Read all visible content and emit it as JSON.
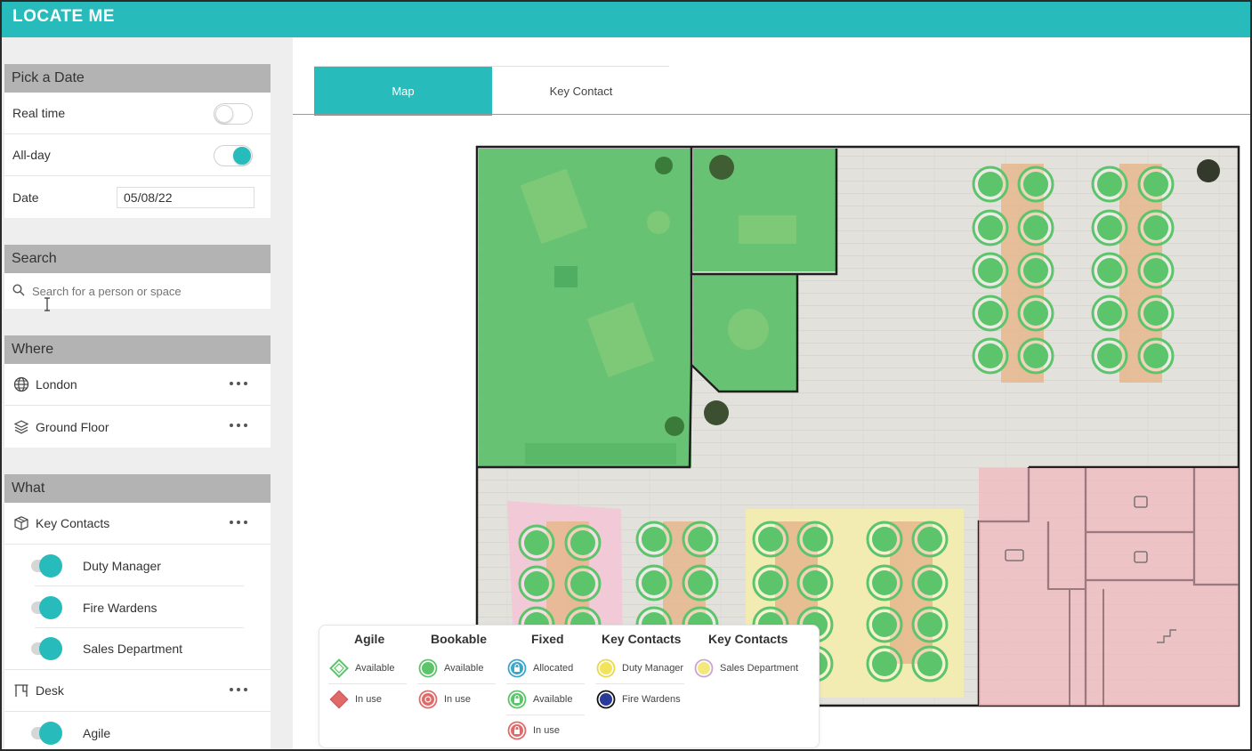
{
  "app": {
    "title": "LOCATE ME"
  },
  "sidebar": {
    "pick_date": {
      "header": "Pick a Date",
      "real_time": {
        "label": "Real time",
        "on": false
      },
      "all_day": {
        "label": "All-day",
        "on": true
      },
      "date": {
        "label": "Date",
        "value": "05/08/22"
      }
    },
    "search": {
      "header": "Search",
      "placeholder": "Search for a person or space"
    },
    "where": {
      "header": "Where",
      "items": [
        {
          "label": "London",
          "icon": "globe-icon"
        },
        {
          "label": "Ground Floor",
          "icon": "layers-icon"
        }
      ]
    },
    "what": {
      "header": "What",
      "key_contacts": {
        "label": "Key Contacts",
        "icon": "box-icon",
        "items": [
          "Duty Manager",
          "Fire Wardens",
          "Sales Department"
        ]
      },
      "desk": {
        "label": "Desk",
        "icon": "desk-icon",
        "items": [
          "Agile"
        ]
      }
    }
  },
  "tabs": [
    {
      "label": "Map",
      "active": true
    },
    {
      "label": "Key Contact",
      "active": false
    }
  ],
  "legend": {
    "columns": [
      {
        "title": "Agile",
        "items": [
          "Available",
          "In use"
        ]
      },
      {
        "title": "Bookable",
        "items": [
          "Available",
          "In use"
        ]
      },
      {
        "title": "Fixed",
        "items": [
          "Allocated",
          "Available",
          "In use"
        ]
      },
      {
        "title": "Key Contacts",
        "items": [
          "Duty Manager",
          "Fire Wardens"
        ]
      },
      {
        "title": "Key Contacts",
        "items": [
          "Sales Department"
        ]
      }
    ]
  },
  "colors": {
    "accent": "#27bcbb",
    "available_green": "#5cc46a",
    "in_use_red": "#e06a6a",
    "allocated_blue": "#3ba7c9",
    "duty_manager_yellow": "#f2e45a",
    "fire_wardens_navy": "#2a3a9a",
    "sales_yellow": "#f4e87c",
    "sales_zone": "#f2ebb2",
    "pink_zone": "#f3c9cf",
    "floor": "#e4e2dd"
  }
}
